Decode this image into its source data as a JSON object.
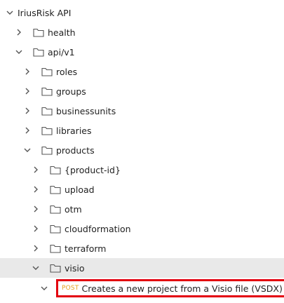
{
  "tree": {
    "root": {
      "label": "IriusRisk API",
      "expanded": true
    },
    "nodes": [
      {
        "label": "health",
        "expanded": false,
        "depth": 1
      },
      {
        "label": "api/v1",
        "expanded": true,
        "depth": 1
      },
      {
        "label": "roles",
        "expanded": false,
        "depth": 2
      },
      {
        "label": "groups",
        "expanded": false,
        "depth": 2
      },
      {
        "label": "businessunits",
        "expanded": false,
        "depth": 2
      },
      {
        "label": "libraries",
        "expanded": false,
        "depth": 2
      },
      {
        "label": "products",
        "expanded": true,
        "depth": 2
      },
      {
        "label": "{product-id}",
        "expanded": false,
        "depth": 3
      },
      {
        "label": "upload",
        "expanded": false,
        "depth": 3
      },
      {
        "label": "otm",
        "expanded": false,
        "depth": 3
      },
      {
        "label": "cloudformation",
        "expanded": false,
        "depth": 3
      },
      {
        "label": "terraform",
        "expanded": false,
        "depth": 3
      },
      {
        "label": "visio",
        "expanded": true,
        "depth": 3,
        "selected": true
      }
    ],
    "endpoint": {
      "method": "POST",
      "label": "Creates a new project from a Visio file (VSDX)",
      "expanded": true,
      "depth": 4
    }
  },
  "colors": {
    "method_post": "#e8a21d",
    "highlight_box": "#e3000f",
    "selected_row": "#e9e9e9",
    "icon_stroke": "#555555"
  }
}
